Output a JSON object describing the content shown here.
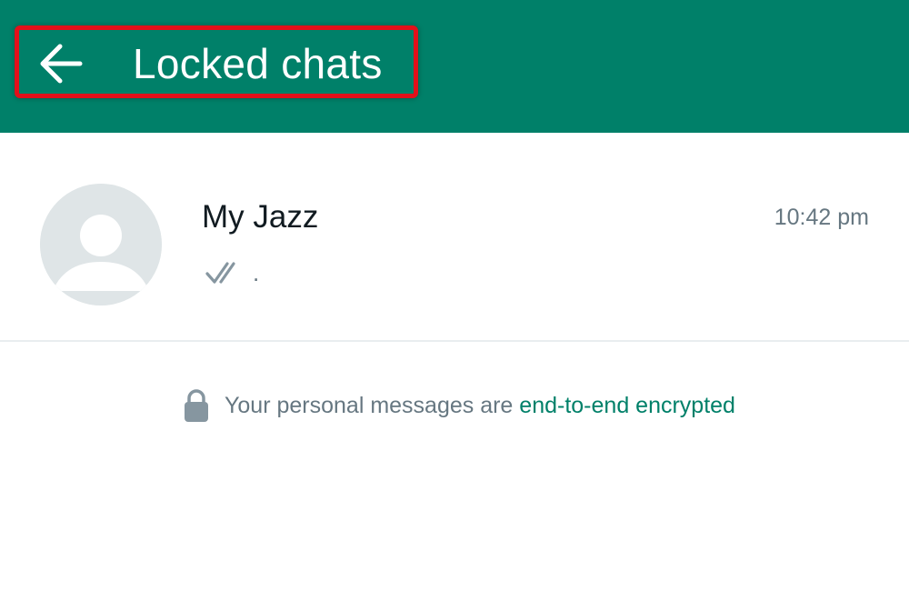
{
  "header": {
    "title": "Locked chats",
    "background_color": "#008069",
    "back_icon": "arrow-left-icon",
    "highlight_color": "#e3101a"
  },
  "chats": [
    {
      "name": "My Jazz",
      "time": "10:42 pm",
      "preview": ".",
      "status_icon": "double-check-icon",
      "avatar_icon": "default-avatar-icon"
    }
  ],
  "encryption_notice": {
    "text": "Your personal messages are ",
    "link_text": "end-to-end encrypted",
    "icon": "lock-icon",
    "link_color": "#008069"
  }
}
